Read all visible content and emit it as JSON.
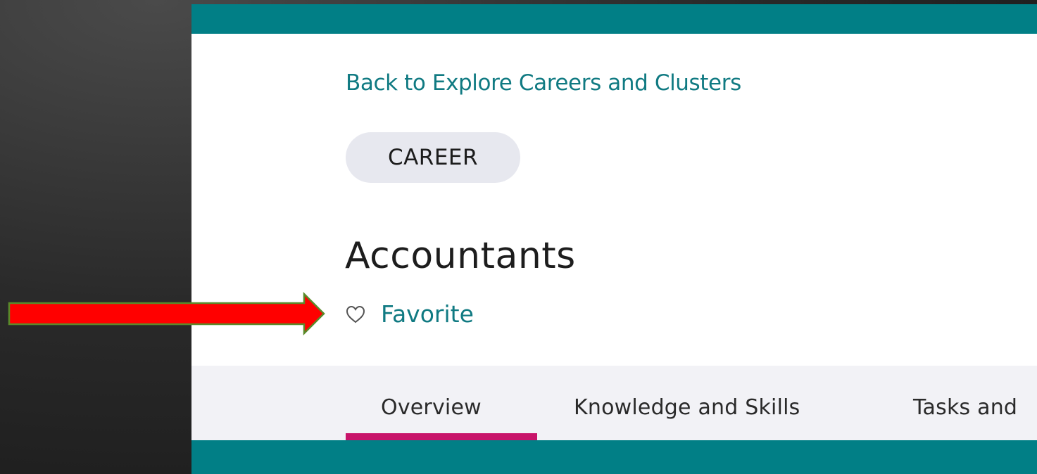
{
  "nav": {
    "back_label": "Back to Explore Careers and Clusters"
  },
  "badge": {
    "label": "CAREER"
  },
  "page": {
    "title": "Accountants"
  },
  "favorite": {
    "label": "Favorite",
    "icon": "heart-outline-icon"
  },
  "tabs": [
    {
      "label": "Overview",
      "active": true
    },
    {
      "label": "Knowledge and Skills",
      "active": false
    },
    {
      "label": "Tasks and",
      "active": false
    }
  ],
  "colors": {
    "accent_teal": "#017f86",
    "link_teal": "#107a82",
    "active_tab": "#c8146a",
    "annotation_arrow": "#ff0000"
  }
}
